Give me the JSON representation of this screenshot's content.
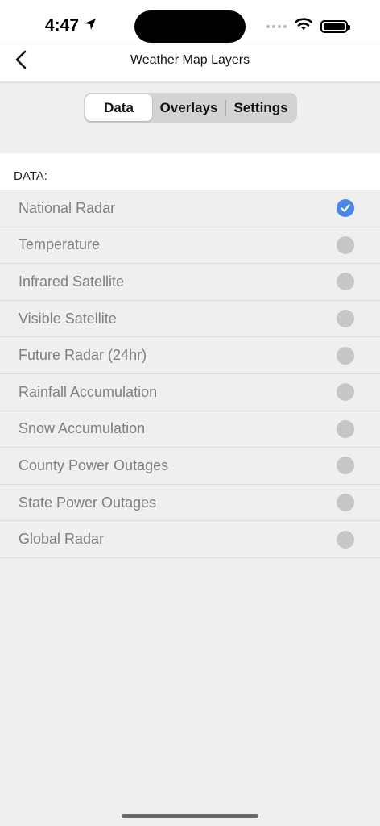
{
  "status": {
    "time": "4:47"
  },
  "nav": {
    "title": "Weather Map Layers"
  },
  "segments": [
    "Data",
    "Overlays",
    "Settings"
  ],
  "active_segment": "Data",
  "section": {
    "label": "DATA:"
  },
  "layers": [
    {
      "label": "National Radar",
      "selected": true
    },
    {
      "label": "Temperature",
      "selected": false
    },
    {
      "label": "Infrared Satellite",
      "selected": false
    },
    {
      "label": "Visible Satellite",
      "selected": false
    },
    {
      "label": "Future Radar (24hr)",
      "selected": false
    },
    {
      "label": "Rainfall Accumulation",
      "selected": false
    },
    {
      "label": "Snow Accumulation",
      "selected": false
    },
    {
      "label": "County Power Outages",
      "selected": false
    },
    {
      "label": "State Power Outages",
      "selected": false
    },
    {
      "label": "Global Radar",
      "selected": false
    }
  ],
  "colors": {
    "accent": "#4a87e8",
    "row_text": "#7f7f7f",
    "background": "#efefef"
  }
}
